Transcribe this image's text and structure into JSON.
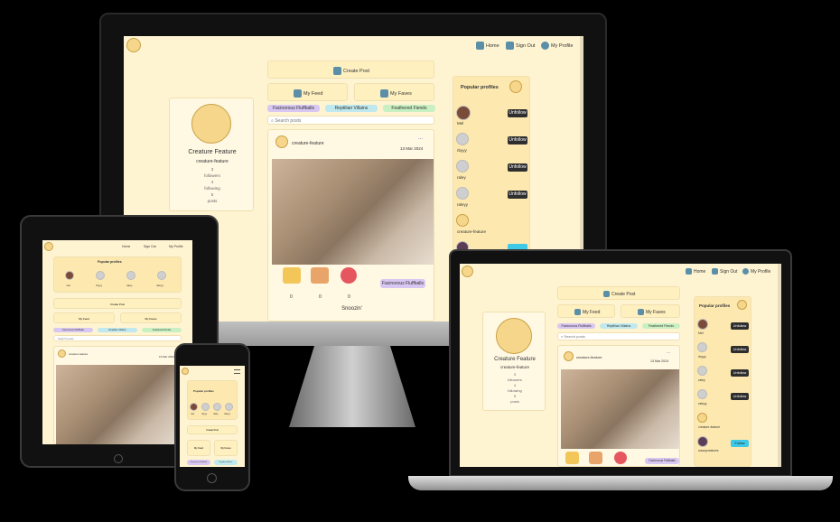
{
  "nav": {
    "home": "Home",
    "sign_out": "Sign Out",
    "my_profile": "My Profile"
  },
  "create_post": "Create Post",
  "my_feed": "My Feed",
  "my_faves": "My Faves",
  "categories": [
    "Facinorous Fluffballs",
    "Reptilian Villains",
    "Feathered Fiends"
  ],
  "search_placeholder": "Search posts",
  "profile": {
    "name": "Creature Feature",
    "username": "creature-feature",
    "followers_count": "3",
    "followers_label": "followers",
    "following_count": "4",
    "following_label": "following",
    "posts_count": "5",
    "posts_label": "posts"
  },
  "post": {
    "author": "creature-feature",
    "menu": "...",
    "date": "13 Mar 2024",
    "category": "Facinorous Fluffballs",
    "reactions": [
      "0",
      "0",
      "0"
    ],
    "title": "Snoozin'"
  },
  "popular": {
    "title": "Popular profiles",
    "users": [
      {
        "name": "Mel",
        "action": "Unfollow"
      },
      {
        "name": "rbyyy",
        "action": "Unfollow"
      },
      {
        "name": "raley",
        "action": "Unfollow"
      },
      {
        "name": "raleyy",
        "action": "Unfollow"
      },
      {
        "name": "creature-feature",
        "action": ""
      }
    ],
    "follow_label": "Follow",
    "extra_user": "crazzycreatures"
  },
  "tablet": {
    "popular_users": [
      "mel",
      "rbyyy",
      "raley",
      "raleyy"
    ],
    "date": "13 Mar 2024"
  },
  "phone": {
    "popular_users": [
      "mel",
      "rbyyy",
      "raley",
      "raleyy"
    ]
  },
  "colors": {
    "bg": "#fff4d2",
    "card": "#fff8e3",
    "purple": "#d8c7f2",
    "teal": "#bfe9ee",
    "green": "#c9f0c2",
    "dark_btn": "#2e2e2e",
    "follow": "#3ec9e6"
  }
}
